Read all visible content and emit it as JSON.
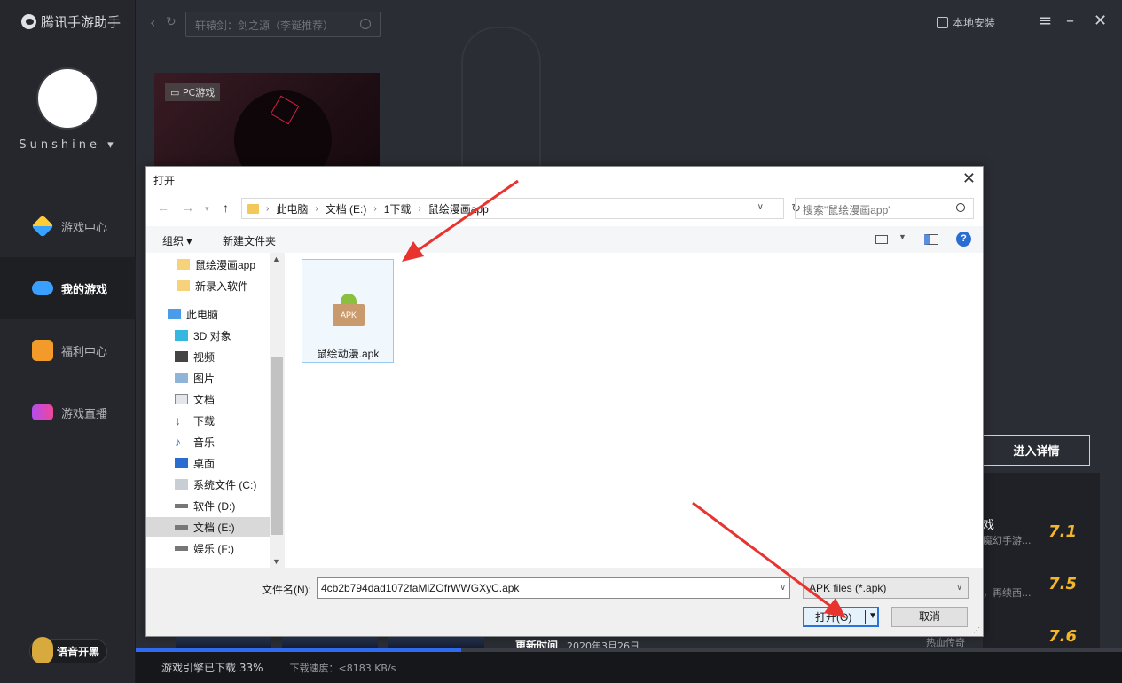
{
  "app": {
    "title": "腾讯手游助手"
  },
  "user": {
    "name": "Sunshine"
  },
  "nav": [
    {
      "label": "游戏中心",
      "icon": "game-center-icon"
    },
    {
      "label": "我的游戏",
      "icon": "gamepad-icon"
    },
    {
      "label": "福利中心",
      "icon": "gift-icon"
    },
    {
      "label": "游戏直播",
      "icon": "live-icon"
    }
  ],
  "voice": {
    "label": "语音开黑"
  },
  "topbar": {
    "search_placeholder": "轩辕剑：剑之源（李诞推荐）",
    "local_install": "本地安装"
  },
  "background": {
    "game_tag": "PC游戏",
    "detail_button": "进入详情",
    "ratings": [
      {
        "score": "7.1",
        "title": "戏",
        "desc": "魔幻手游..."
      },
      {
        "score": "7.5",
        "title": "",
        "desc": "，再续西..."
      },
      {
        "score": "7.6",
        "title": "",
        "desc": "热血传奇"
      }
    ],
    "update_label": "更新时间",
    "update_date": "2020年3月26日"
  },
  "status": {
    "download_text": "游戏引擎已下载 33%",
    "progress": 33,
    "speed": "下载速度：<8183 KB/s"
  },
  "dialog": {
    "title": "打开",
    "path": [
      "此电脑",
      "文档 (E:)",
      "1下载",
      "鼠绘漫画app"
    ],
    "search_placeholder": "搜索\"鼠绘漫画app\"",
    "organize": "组织",
    "new_folder": "新建文件夹",
    "tree": [
      {
        "label": "鼠绘漫画app",
        "icon": "folder-icon",
        "level": 2
      },
      {
        "label": "新录入软件",
        "icon": "folder-icon",
        "level": 2
      },
      {
        "label": "此电脑",
        "icon": "computer-icon",
        "level": 1
      },
      {
        "label": "3D 对象",
        "icon": "cube-icon",
        "level": 2
      },
      {
        "label": "视频",
        "icon": "video-icon",
        "level": 2
      },
      {
        "label": "图片",
        "icon": "picture-icon",
        "level": 2
      },
      {
        "label": "文档",
        "icon": "document-icon",
        "level": 2
      },
      {
        "label": "下载",
        "icon": "download-icon",
        "level": 2
      },
      {
        "label": "音乐",
        "icon": "music-icon",
        "level": 2
      },
      {
        "label": "桌面",
        "icon": "desktop-icon",
        "level": 2
      },
      {
        "label": "系统文件 (C:)",
        "icon": "system-drive-icon",
        "level": 2
      },
      {
        "label": "软件 (D:)",
        "icon": "drive-icon",
        "level": 2
      },
      {
        "label": "文档 (E:)",
        "icon": "drive-icon",
        "level": 2,
        "selected": true
      },
      {
        "label": "娱乐 (F:)",
        "icon": "drive-icon",
        "level": 2
      }
    ],
    "file": {
      "name": "鼠绘动漫.apk",
      "icon_text": "APK"
    },
    "filename_label": "文件名(N):",
    "filename_value": "4cb2b794dad1072faMlZOfrWWGXyC.apk",
    "filetype": "APK files (*.apk)",
    "open_button": "打开(O)",
    "cancel_button": "取消"
  },
  "colors": {
    "accent": "#2f6bf0",
    "rating": "#f3b52a",
    "arrow": "#e8332f"
  }
}
